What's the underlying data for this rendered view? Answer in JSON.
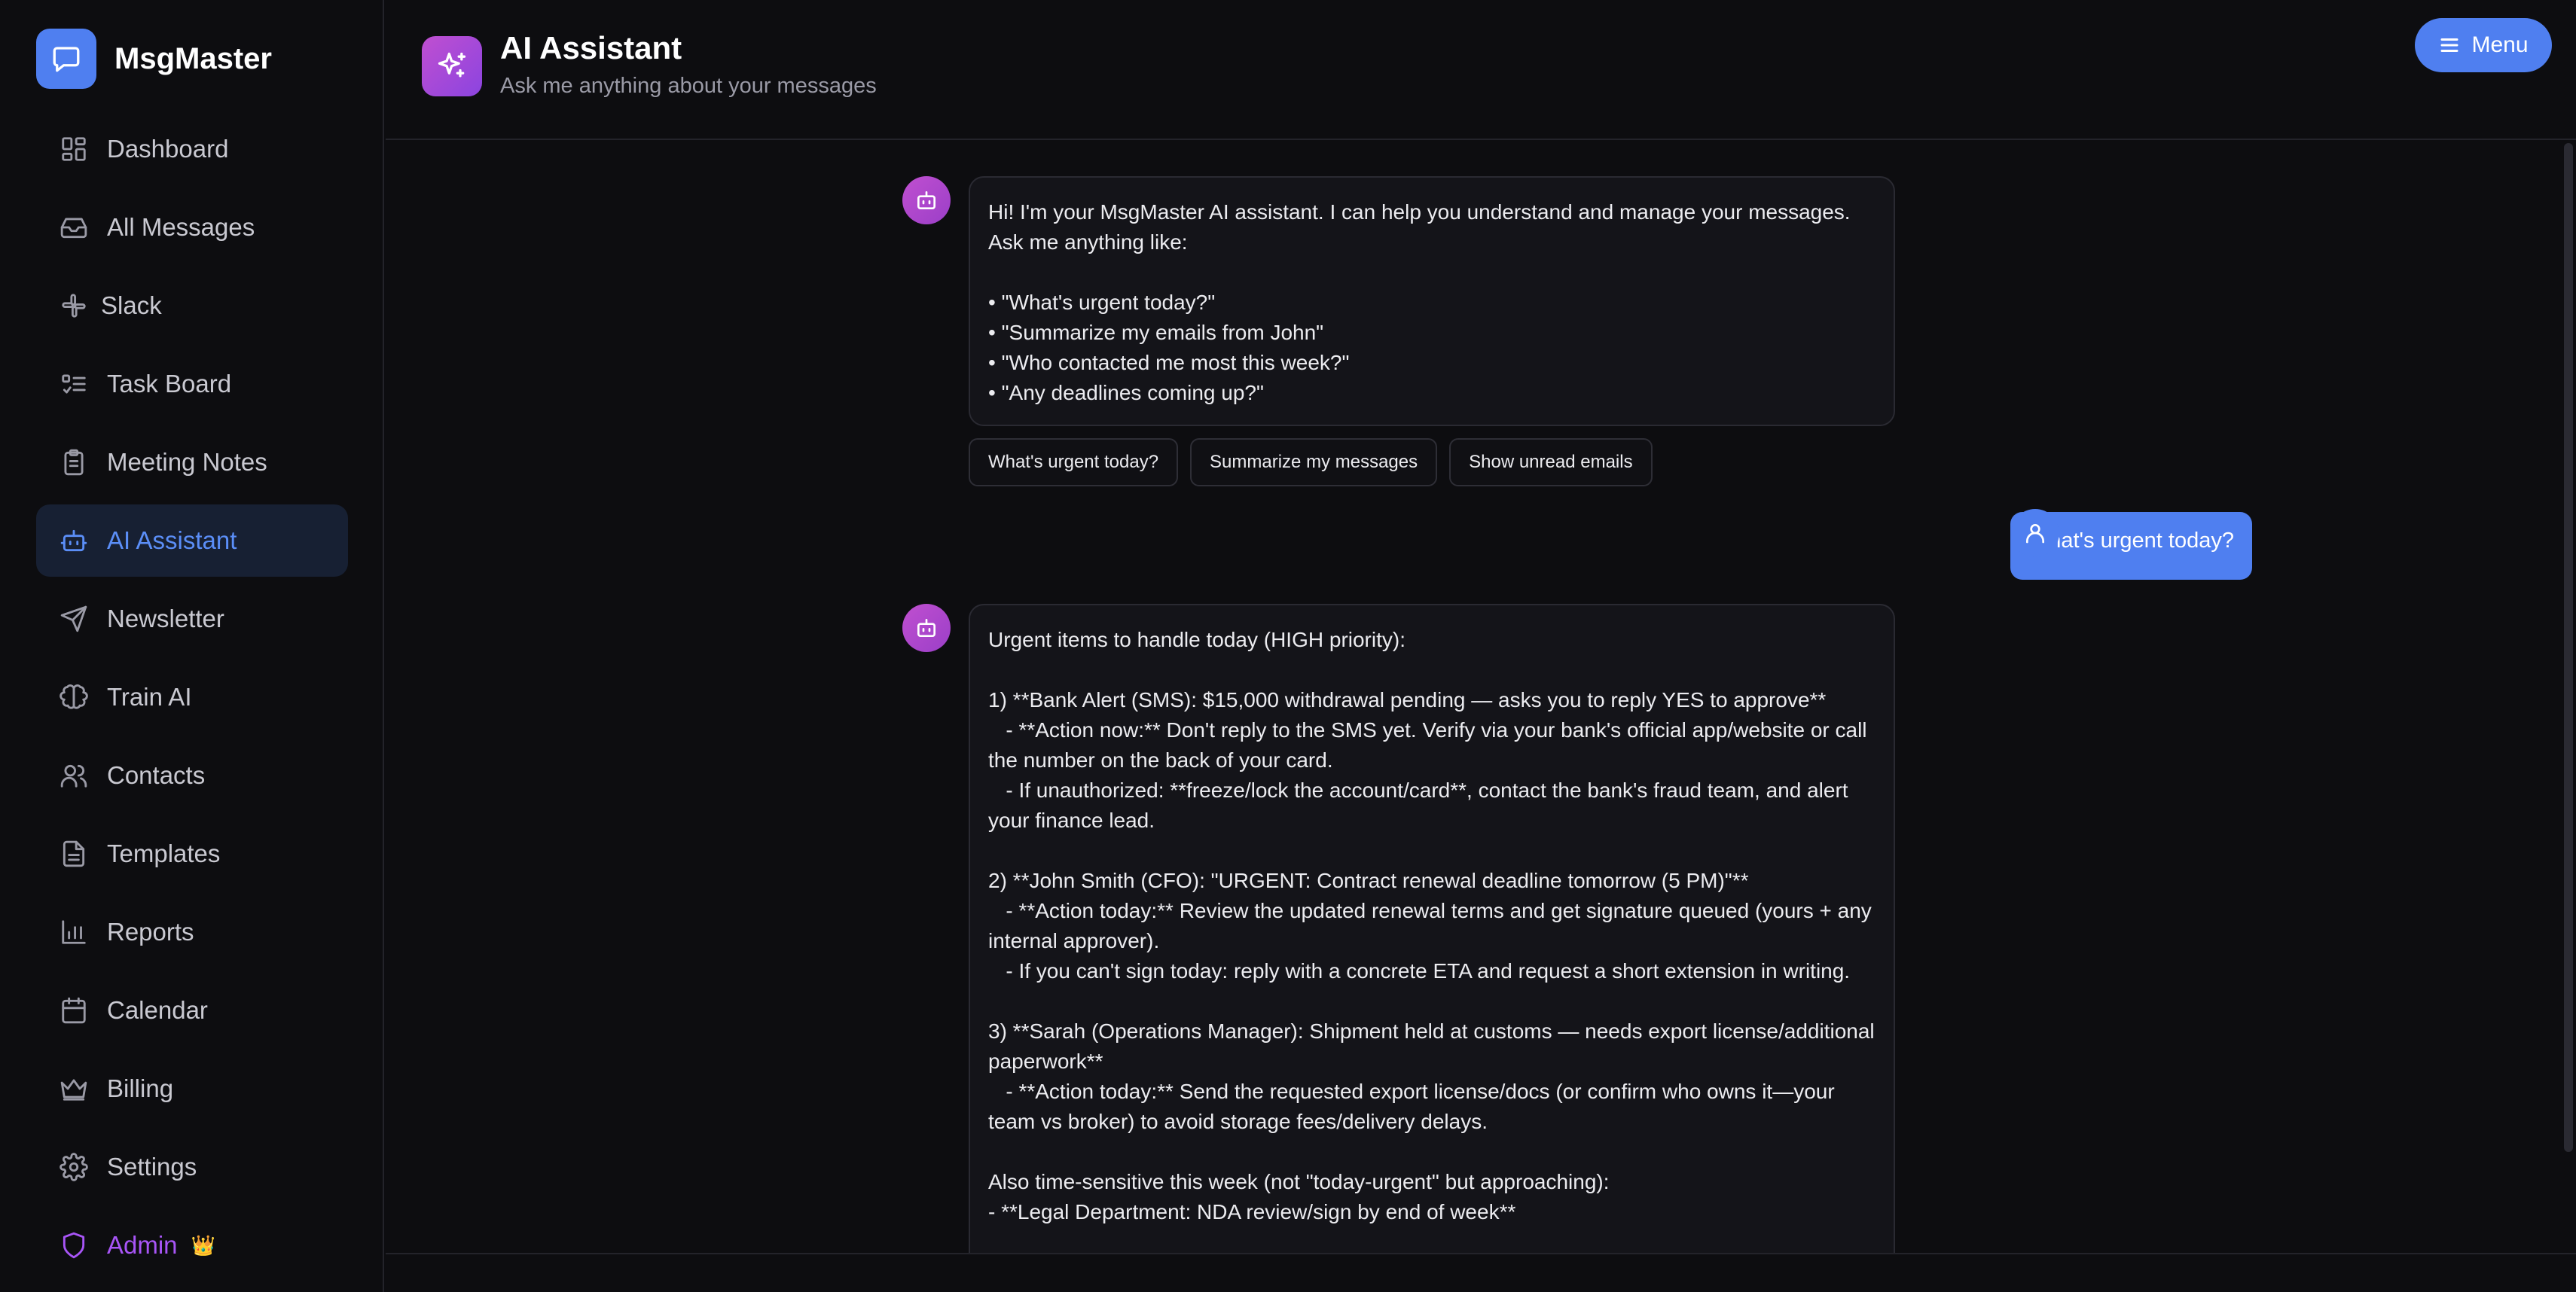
{
  "brand": {
    "name": "MsgMaster"
  },
  "sidebar": {
    "items": [
      {
        "label": "Dashboard"
      },
      {
        "label": "All Messages"
      },
      {
        "label": "Slack"
      },
      {
        "label": "Task Board"
      },
      {
        "label": "Meeting Notes"
      },
      {
        "label": "AI Assistant",
        "active": true
      },
      {
        "label": "Newsletter"
      },
      {
        "label": "Train AI"
      },
      {
        "label": "Contacts"
      },
      {
        "label": "Templates"
      },
      {
        "label": "Reports"
      },
      {
        "label": "Calendar"
      },
      {
        "label": "Billing"
      },
      {
        "label": "Settings"
      },
      {
        "label": "Admin",
        "badge": "👑"
      }
    ]
  },
  "header": {
    "title": "AI Assistant",
    "subtitle": "Ask me anything about your messages",
    "menu_label": "Menu"
  },
  "chat": {
    "welcome": "Hi! I'm your MsgMaster AI assistant. I can help you understand and manage your messages. Ask me anything like:\n\n• \"What's urgent today?\"\n• \"Summarize my emails from John\"\n• \"Who contacted me most this week?\"\n• \"Any deadlines coming up?\"",
    "suggestions": [
      "What's urgent today?",
      "Summarize my messages",
      "Show unread emails"
    ],
    "user_message": "What's urgent today?",
    "response": "Urgent items to handle today (HIGH priority):\n\n1) **Bank Alert (SMS): $15,000 withdrawal pending — asks you to reply YES to approve**\n   - **Action now:** Don't reply to the SMS yet. Verify via your bank's official app/website or call the number on the back of your card.\n   - If unauthorized: **freeze/lock the account/card**, contact the bank's fraud team, and alert your finance lead.\n\n2) **John Smith (CFO): \"URGENT: Contract renewal deadline tomorrow (5 PM)\"**\n   - **Action today:** Review the updated renewal terms and get signature queued (yours + any internal approver).\n   - If you can't sign today: reply with a concrete ETA and request a short extension in writing.\n\n3) **Sarah (Operations Manager): Shipment held at customs — needs export license/additional paperwork**\n   - **Action today:** Send the requested export license/docs (or confirm who owns it—your team vs broker) to avoid storage fees/delivery delays.\n\nAlso time-sensitive this week (not \"today-urgent\" but approaching):\n- **Legal Department: NDA review/sign by end of week**"
  },
  "colors": {
    "accent": "#4f7ff0",
    "active_nav_text": "#5b8ef7",
    "admin": "#a855f7",
    "bot_gradient": "#c04fd0"
  },
  "icons": [
    "chat-bubble-icon",
    "dashboard-icon",
    "inbox-icon",
    "slack-icon",
    "task-list-icon",
    "clipboard-icon",
    "bot-icon",
    "send-icon",
    "brain-icon",
    "users-icon",
    "file-text-icon",
    "bar-chart-icon",
    "calendar-icon",
    "crown-icon",
    "gear-icon",
    "shield-icon",
    "sparkles-icon",
    "hamburger-icon",
    "user-icon"
  ]
}
